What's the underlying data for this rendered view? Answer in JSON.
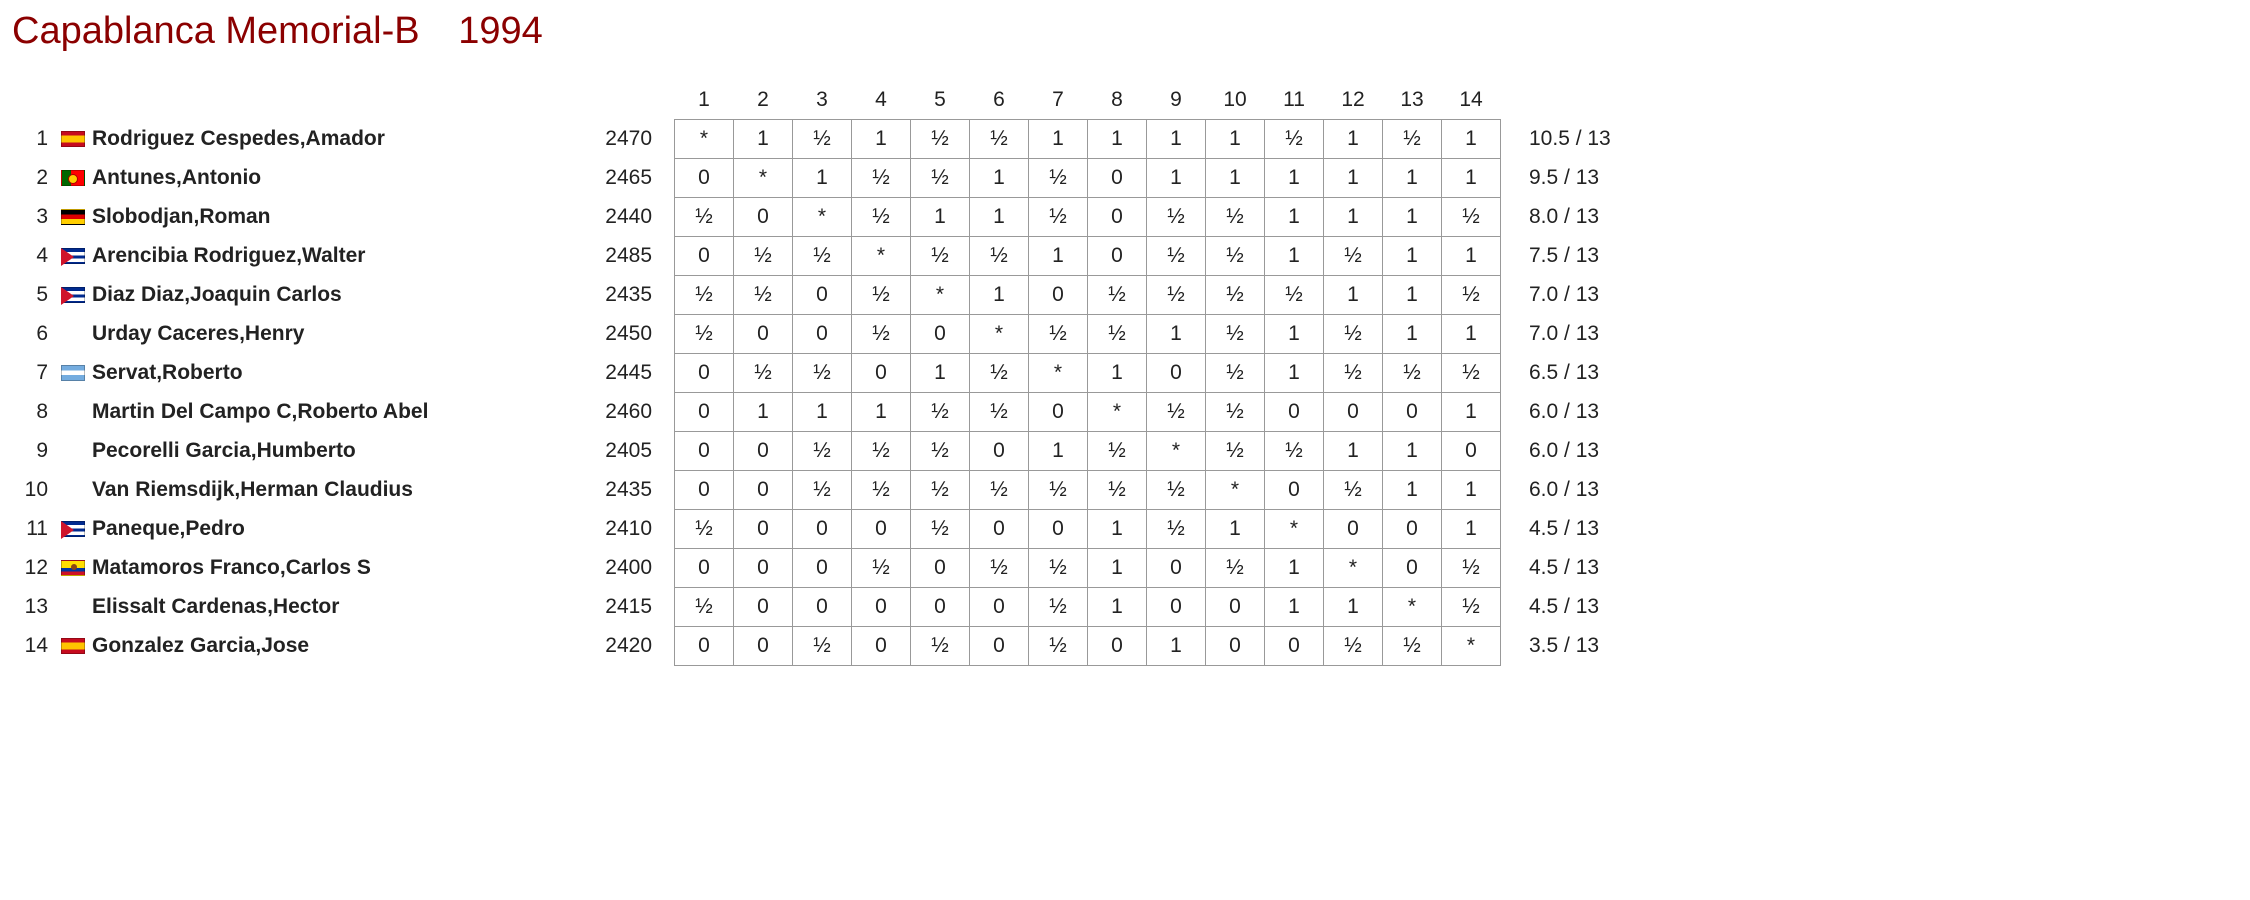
{
  "title": "Capablanca Memorial-B",
  "year": "1994",
  "columns": [
    "1",
    "2",
    "3",
    "4",
    "5",
    "6",
    "7",
    "8",
    "9",
    "10",
    "11",
    "12",
    "13",
    "14"
  ],
  "players": [
    {
      "rank": "1",
      "flag": "es",
      "name": "Rodriguez Cespedes,Amador",
      "rating": "2470",
      "results": [
        "*",
        "1",
        "½",
        "1",
        "½",
        "½",
        "1",
        "1",
        "1",
        "1",
        "½",
        "1",
        "½",
        "1"
      ],
      "score": "10.5 / 13"
    },
    {
      "rank": "2",
      "flag": "pt",
      "name": "Antunes,Antonio",
      "rating": "2465",
      "results": [
        "0",
        "*",
        "1",
        "½",
        "½",
        "1",
        "½",
        "0",
        "1",
        "1",
        "1",
        "1",
        "1",
        "1"
      ],
      "score": "9.5 / 13"
    },
    {
      "rank": "3",
      "flag": "de",
      "name": "Slobodjan,Roman",
      "rating": "2440",
      "results": [
        "½",
        "0",
        "*",
        "½",
        "1",
        "1",
        "½",
        "0",
        "½",
        "½",
        "1",
        "1",
        "1",
        "½"
      ],
      "score": "8.0 / 13"
    },
    {
      "rank": "4",
      "flag": "cu",
      "name": "Arencibia Rodriguez,Walter",
      "rating": "2485",
      "results": [
        "0",
        "½",
        "½",
        "*",
        "½",
        "½",
        "1",
        "0",
        "½",
        "½",
        "1",
        "½",
        "1",
        "1"
      ],
      "score": "7.5 / 13"
    },
    {
      "rank": "5",
      "flag": "cu",
      "name": "Diaz Diaz,Joaquin Carlos",
      "rating": "2435",
      "results": [
        "½",
        "½",
        "0",
        "½",
        "*",
        "1",
        "0",
        "½",
        "½",
        "½",
        "½",
        "1",
        "1",
        "½"
      ],
      "score": "7.0 / 13"
    },
    {
      "rank": "6",
      "flag": "none",
      "name": "Urday Caceres,Henry",
      "rating": "2450",
      "results": [
        "½",
        "0",
        "0",
        "½",
        "0",
        "*",
        "½",
        "½",
        "1",
        "½",
        "1",
        "½",
        "1",
        "1"
      ],
      "score": "7.0 / 13"
    },
    {
      "rank": "7",
      "flag": "ar",
      "name": "Servat,Roberto",
      "rating": "2445",
      "results": [
        "0",
        "½",
        "½",
        "0",
        "1",
        "½",
        "*",
        "1",
        "0",
        "½",
        "1",
        "½",
        "½",
        "½"
      ],
      "score": "6.5 / 13"
    },
    {
      "rank": "8",
      "flag": "none",
      "name": "Martin Del Campo C,Roberto Abel",
      "rating": "2460",
      "results": [
        "0",
        "1",
        "1",
        "1",
        "½",
        "½",
        "0",
        "*",
        "½",
        "½",
        "0",
        "0",
        "0",
        "1"
      ],
      "score": "6.0 / 13"
    },
    {
      "rank": "9",
      "flag": "none",
      "name": "Pecorelli Garcia,Humberto",
      "rating": "2405",
      "results": [
        "0",
        "0",
        "½",
        "½",
        "½",
        "0",
        "1",
        "½",
        "*",
        "½",
        "½",
        "1",
        "1",
        "0"
      ],
      "score": "6.0 / 13"
    },
    {
      "rank": "10",
      "flag": "none",
      "name": "Van Riemsdijk,Herman Claudius",
      "rating": "2435",
      "results": [
        "0",
        "0",
        "½",
        "½",
        "½",
        "½",
        "½",
        "½",
        "½",
        "*",
        "0",
        "½",
        "1",
        "1"
      ],
      "score": "6.0 / 13"
    },
    {
      "rank": "11",
      "flag": "cu",
      "name": "Paneque,Pedro",
      "rating": "2410",
      "results": [
        "½",
        "0",
        "0",
        "0",
        "½",
        "0",
        "0",
        "1",
        "½",
        "1",
        "*",
        "0",
        "0",
        "1"
      ],
      "score": "4.5 / 13"
    },
    {
      "rank": "12",
      "flag": "ec",
      "name": "Matamoros Franco,Carlos S",
      "rating": "2400",
      "results": [
        "0",
        "0",
        "0",
        "½",
        "0",
        "½",
        "½",
        "1",
        "0",
        "½",
        "1",
        "*",
        "0",
        "½"
      ],
      "score": "4.5 / 13"
    },
    {
      "rank": "13",
      "flag": "none",
      "name": "Elissalt Cardenas,Hector",
      "rating": "2415",
      "results": [
        "½",
        "0",
        "0",
        "0",
        "0",
        "0",
        "½",
        "1",
        "0",
        "0",
        "1",
        "1",
        "*",
        "½"
      ],
      "score": "4.5 / 13"
    },
    {
      "rank": "14",
      "flag": "es",
      "name": "Gonzalez Garcia,Jose",
      "rating": "2420",
      "results": [
        "0",
        "0",
        "½",
        "0",
        "½",
        "0",
        "½",
        "0",
        "1",
        "0",
        "0",
        "½",
        "½",
        "*"
      ],
      "score": "3.5 / 13"
    }
  ]
}
